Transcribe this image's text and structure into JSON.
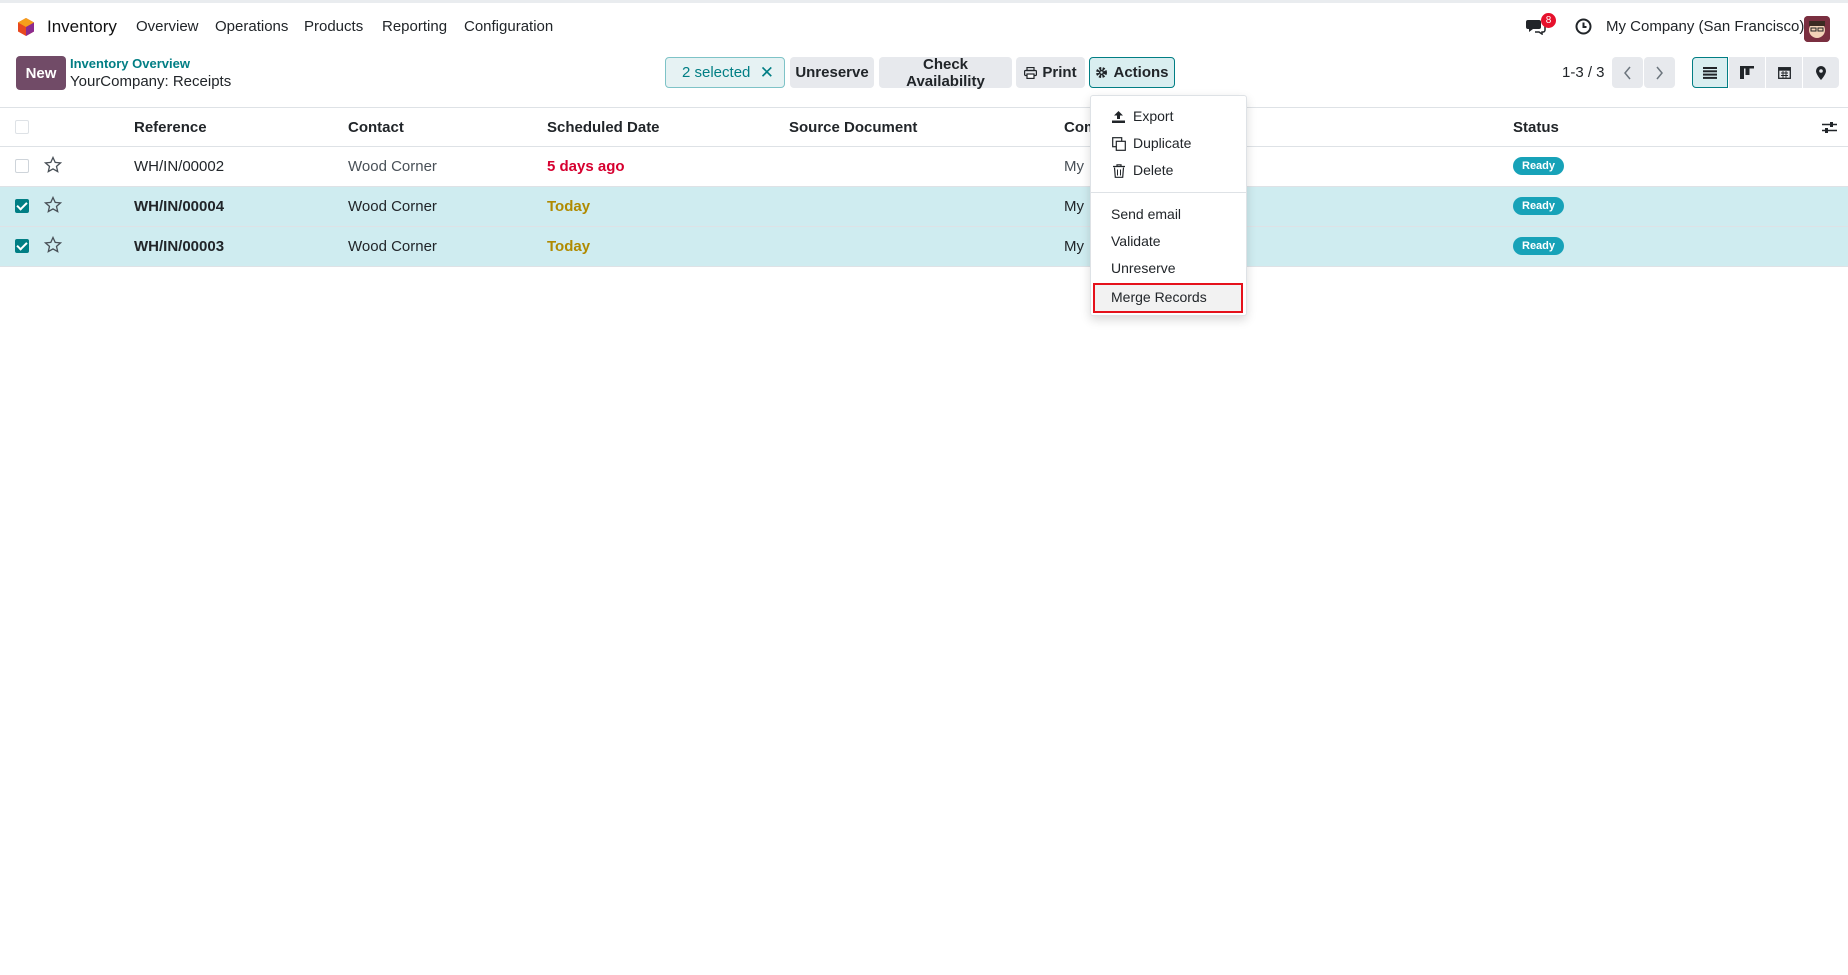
{
  "app": {
    "name": "Inventory",
    "menu": [
      "Overview",
      "Operations",
      "Products",
      "Reporting",
      "Configuration"
    ],
    "chat_count": "8",
    "company": "My Company (San Francisco)"
  },
  "control_panel": {
    "new_label": "New",
    "breadcrumb_parent": "Inventory Overview",
    "breadcrumb_current": "YourCompany: Receipts",
    "selected_label": "2 selected",
    "unreserve_label": "Unreserve",
    "check_availability_label": "Check Availability",
    "print_label": "Print",
    "actions_label": "Actions",
    "pager": "1-3 / 3"
  },
  "table": {
    "columns": [
      "Reference",
      "Contact",
      "Scheduled Date",
      "Source Document",
      "Com",
      "Status"
    ],
    "rows": [
      {
        "reference": "WH/IN/00002",
        "contact": "Wood Corner",
        "date": "5 days ago",
        "company": "My",
        "status": "Ready",
        "selected": false
      },
      {
        "reference": "WH/IN/00004",
        "contact": "Wood Corner",
        "date": "Today",
        "company": "My",
        "status": "Ready",
        "selected": true
      },
      {
        "reference": "WH/IN/00003",
        "contact": "Wood Corner",
        "date": "Today",
        "company": "My",
        "status": "Ready",
        "selected": true
      }
    ]
  },
  "actions_menu": {
    "export": "Export",
    "duplicate": "Duplicate",
    "delete": "Delete",
    "send_email": "Send email",
    "validate": "Validate",
    "unreserve": "Unreserve",
    "merge_records": "Merge Records"
  },
  "colors": {
    "brand": "#714b67",
    "teal": "#017e84",
    "overdue": "#d6002f",
    "today": "#b08a00",
    "ready_badge": "#17a2b8",
    "highlight": "#e5121c"
  }
}
